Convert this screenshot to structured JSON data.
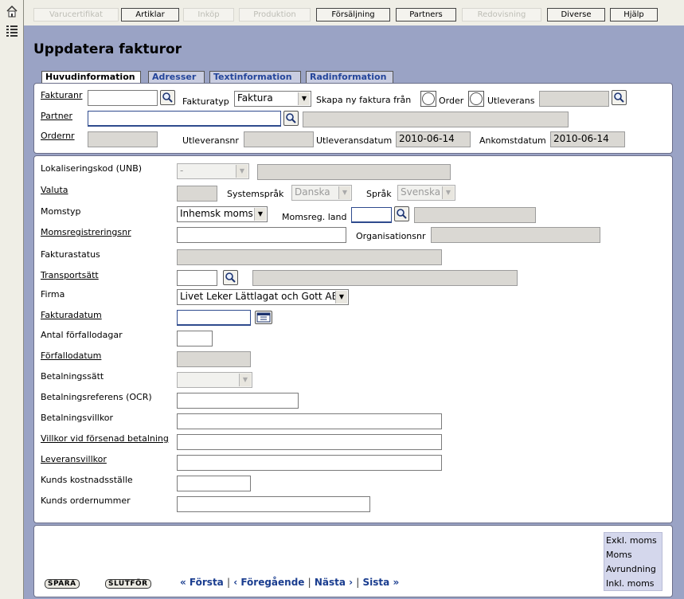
{
  "menu": [
    {
      "label": "Varucertifikat",
      "enabled": false
    },
    {
      "label": "Artiklar",
      "enabled": true
    },
    {
      "label": "Inköp",
      "enabled": false
    },
    {
      "label": "Produktion",
      "enabled": false
    },
    {
      "label": "Försäljning",
      "enabled": true
    },
    {
      "label": "Partners",
      "enabled": true
    },
    {
      "label": "Redovisning",
      "enabled": false
    },
    {
      "label": "Diverse",
      "enabled": true
    },
    {
      "label": "Hjälp",
      "enabled": true
    }
  ],
  "page_title": "Uppdatera fakturor",
  "tabs": [
    {
      "label": "Huvudinformation",
      "active": true
    },
    {
      "label": "Adresser",
      "active": false
    },
    {
      "label": "Textinformation",
      "active": false
    },
    {
      "label": "Radinformation",
      "active": false
    }
  ],
  "header": {
    "fakturanr_label": "Fakturanr",
    "fakturanr_value": "",
    "fakturatyp_label": "Fakturatyp",
    "fakturatyp_value": "Faktura",
    "skapa_label": "Skapa ny faktura från",
    "order_label": "Order",
    "utleverans_label": "Utleverans",
    "utleverans_value": "",
    "partner_label": "Partner",
    "partner_value": "",
    "partner_name": "",
    "ordernr_label": "Ordernr",
    "ordernr_value": "",
    "utleveransnr_label": "Utleveransnr",
    "utleveransnr_value": "",
    "utleveransdatum_label": "Utleveransdatum",
    "utleveransdatum_value": "2010-06-14",
    "ankomstdatum_label": "Ankomstdatum",
    "ankomstdatum_value": "2010-06-14"
  },
  "main": {
    "lokaliseringskod_label": "Lokaliseringskod (UNB)",
    "lokaliseringskod_value": "-",
    "valuta_label": "Valuta",
    "systemsprak_label": "Systemspråk",
    "systemsprak_value": "Danska",
    "sprak_label": "Språk",
    "sprak_value": "Svenska",
    "momstyp_label": "Momstyp",
    "momstyp_value": "Inhemsk moms",
    "momsreg_land_label": "Momsreg. land",
    "momsregistreringsnr_label": "Momsregistreringsnr",
    "organisationsnr_label": "Organisationsnr",
    "fakturastatus_label": "Fakturastatus",
    "transportsatt_label": "Transportsätt",
    "firma_label": "Firma",
    "firma_value": "Livet Leker Lättlagat och Gott AB",
    "fakturadatum_label": "Fakturadatum",
    "antal_forfallodagar_label": "Antal förfallodagar",
    "forfallodatum_label": "Förfallodatum",
    "betalningssatt_label": "Betalningssätt",
    "betalningsreferens_label": "Betalningsreferens (OCR)",
    "betalningsvillkor_label": "Betalningsvillkor",
    "villkor_forsenad_label": "Villkor vid försenad betalning",
    "leveransvillkor_label": "Leveransvillkor",
    "kunds_kostnadsstalle_label": "Kunds kostnadsställe",
    "kunds_ordernummer_label": "Kunds ordernummer"
  },
  "summary": {
    "exkl_moms": "Exkl. moms",
    "moms": "Moms",
    "avrundning": "Avrundning",
    "inkl_moms": "Inkl. moms"
  },
  "actions": {
    "spara": "SPARA",
    "slutfor": "SLUTFÖR"
  },
  "pager": {
    "forsta": "« Första",
    "foregaende": "‹ Föregående",
    "nasta": "Nästa ›",
    "sista": "Sista »",
    "separator": "|"
  }
}
